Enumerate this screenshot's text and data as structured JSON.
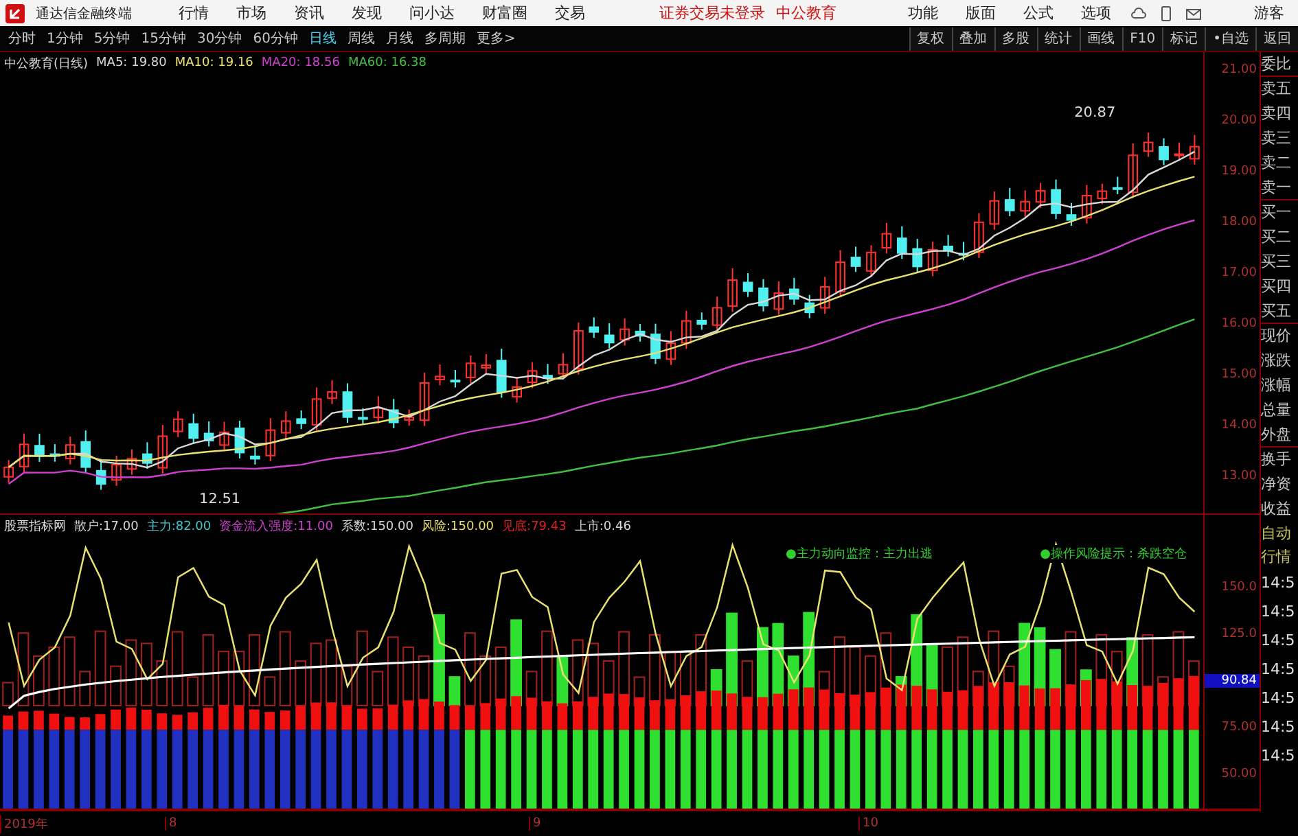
{
  "title_bar": {
    "app_name": "通达信金融终端",
    "menus": [
      "行情",
      "市场",
      "资讯",
      "发现",
      "问小达",
      "财富圈",
      "交易"
    ],
    "notices": [
      "证券交易未登录",
      "中公教育"
    ],
    "tools": [
      "功能",
      "版面",
      "公式",
      "选项"
    ],
    "user": "游客"
  },
  "toolbar": {
    "periods": [
      {
        "label": "分时",
        "selected": false
      },
      {
        "label": "1分钟",
        "selected": false
      },
      {
        "label": "5分钟",
        "selected": false
      },
      {
        "label": "15分钟",
        "selected": false
      },
      {
        "label": "30分钟",
        "selected": false
      },
      {
        "label": "60分钟",
        "selected": false
      },
      {
        "label": "日线",
        "selected": true
      },
      {
        "label": "周线",
        "selected": false
      },
      {
        "label": "月线",
        "selected": false
      },
      {
        "label": "多周期",
        "selected": false
      },
      {
        "label": "更多>",
        "selected": false
      }
    ],
    "actions": [
      "复权",
      "叠加",
      "多股",
      "统计",
      "画线",
      "F10",
      "标记",
      "•自选",
      "返回"
    ]
  },
  "price_chart": {
    "title": "中公教育(日线)",
    "averages": [
      {
        "label": "MA5:",
        "value": "19.80",
        "color": "#d8d8d8"
      },
      {
        "label": "MA10:",
        "value": "19.16",
        "color": "#e8e070"
      },
      {
        "label": "MA20:",
        "value": "18.56",
        "color": "#d040d0"
      },
      {
        "label": "MA60:",
        "value": "16.38",
        "color": "#40c040"
      }
    ],
    "high_label": "20.87",
    "low_label": "12.51",
    "axis": [
      "21.00",
      "20.00",
      "19.00",
      "18.00",
      "17.00",
      "16.00",
      "15.00",
      "14.00",
      "13.00"
    ]
  },
  "indicator": {
    "name": "股票指标网",
    "values": [
      {
        "label": "散户:",
        "value": "17.00",
        "color": "#d8d8d8"
      },
      {
        "label": "主力:",
        "value": "82.00",
        "color": "#40c8c8"
      },
      {
        "label": "资金流入强度:",
        "value": "11.00",
        "color": "#d040d0"
      },
      {
        "label": "系数:",
        "value": "150.00",
        "color": "#d8d8d8"
      },
      {
        "label": "风险:",
        "value": "150.00",
        "color": "#e8e070"
      },
      {
        "label": "见底:",
        "value": "79.43",
        "color": "#e02020"
      },
      {
        "label": "上市:",
        "value": "0.46",
        "color": "#d8d8d8"
      }
    ],
    "notes": [
      "●主力动向监控：主力出逃",
      "●操作风险提示：杀跌空仓"
    ],
    "axis": [
      {
        "label": "150.0",
        "highlighted": false
      },
      {
        "label": "125.0",
        "highlighted": false
      },
      {
        "label": "90.84",
        "highlighted": true
      },
      {
        "label": "75.00",
        "highlighted": false
      },
      {
        "label": "50.00",
        "highlighted": false
      }
    ]
  },
  "x_axis": [
    "2019年",
    "8",
    "9",
    "10"
  ],
  "quote_panel": {
    "labels": [
      "委比",
      "卖五",
      "卖四",
      "卖三",
      "卖二",
      "卖一",
      "买一",
      "买二",
      "买三",
      "买四",
      "买五",
      "现价",
      "涨跌",
      "涨幅",
      "总量",
      "外盘",
      "换手",
      "净资",
      "收益"
    ],
    "mode": [
      "自动",
      "行情"
    ],
    "times": [
      "14:5",
      "14:5",
      "14:5",
      "14:5",
      "14:5",
      "14:5",
      "14:5"
    ]
  }
}
